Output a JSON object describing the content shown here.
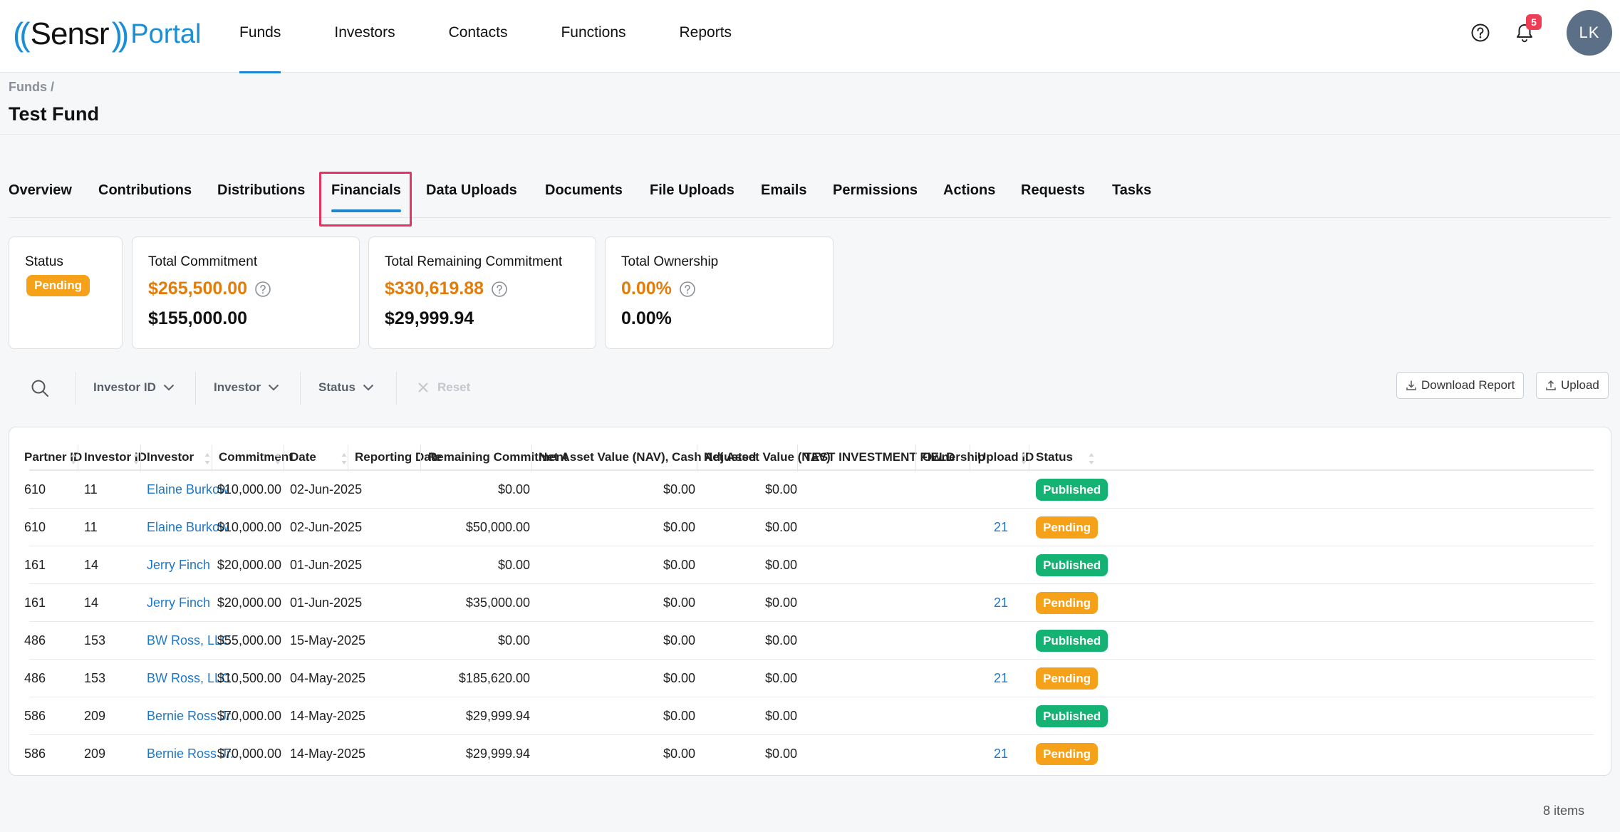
{
  "brand": {
    "left_paren": "((",
    "name": "Sensr",
    "right_paren": "))",
    "product": "Portal"
  },
  "nav": {
    "items": [
      {
        "label": "Funds",
        "active": true
      },
      {
        "label": "Investors"
      },
      {
        "label": "Contacts"
      },
      {
        "label": "Functions"
      },
      {
        "label": "Reports"
      }
    ],
    "notifications_count": "5",
    "avatar_initials": "LK"
  },
  "breadcrumb": "Funds /",
  "page_title": "Test Fund",
  "tabs": [
    {
      "label": "Overview"
    },
    {
      "label": "Contributions"
    },
    {
      "label": "Distributions"
    },
    {
      "label": "Financials",
      "active": true
    },
    {
      "label": "Data Uploads"
    },
    {
      "label": "Documents"
    },
    {
      "label": "File Uploads"
    },
    {
      "label": "Emails"
    },
    {
      "label": "Permissions"
    },
    {
      "label": "Actions"
    },
    {
      "label": "Requests"
    },
    {
      "label": "Tasks"
    }
  ],
  "summary": {
    "status": {
      "label": "Status",
      "value": "Pending"
    },
    "total_commitment": {
      "label": "Total Commitment",
      "pending": "$265,500.00",
      "published": "$155,000.00"
    },
    "total_remaining": {
      "label": "Total Remaining Commitment",
      "pending": "$330,619.88",
      "published": "$29,999.94"
    },
    "total_ownership": {
      "label": "Total Ownership",
      "pending": "0.00%",
      "published": "0.00%"
    }
  },
  "filters": {
    "investor_id": "Investor ID",
    "investor": "Investor",
    "status": "Status",
    "reset": "Reset",
    "download_report": "Download Report",
    "upload": "Upload"
  },
  "table": {
    "columns": [
      "Partner ID",
      "Investor ID",
      "Investor",
      "Commitment",
      "Date",
      "Reporting Date",
      "Remaining Commitment",
      "Net Asset Value (NAV), Cash Adjusted",
      "Net Asset Value (NAV)",
      "TEST INVESTMENT FIELD",
      "Ownership",
      "Upload ID",
      "Status"
    ],
    "rows": [
      {
        "partner_id": "610",
        "investor_id": "11",
        "investor": "Elaine Burkow",
        "commitment": "$10,000.00",
        "date": "02-Jun-2025",
        "reporting_date": "",
        "remaining": "$0.00",
        "nav_cash": "$0.00",
        "nav": "$0.00",
        "test_field": "",
        "ownership": "",
        "upload_id": "",
        "status": "Published"
      },
      {
        "partner_id": "610",
        "investor_id": "11",
        "investor": "Elaine Burkow",
        "commitment": "$10,000.00",
        "date": "02-Jun-2025",
        "reporting_date": "",
        "remaining": "$50,000.00",
        "nav_cash": "$0.00",
        "nav": "$0.00",
        "test_field": "",
        "ownership": "",
        "upload_id": "21",
        "status": "Pending"
      },
      {
        "partner_id": "161",
        "investor_id": "14",
        "investor": "Jerry Finch",
        "commitment": "$20,000.00",
        "date": "01-Jun-2025",
        "reporting_date": "",
        "remaining": "$0.00",
        "nav_cash": "$0.00",
        "nav": "$0.00",
        "test_field": "",
        "ownership": "",
        "upload_id": "",
        "status": "Published"
      },
      {
        "partner_id": "161",
        "investor_id": "14",
        "investor": "Jerry Finch",
        "commitment": "$20,000.00",
        "date": "01-Jun-2025",
        "reporting_date": "",
        "remaining": "$35,000.00",
        "nav_cash": "$0.00",
        "nav": "$0.00",
        "test_field": "",
        "ownership": "",
        "upload_id": "21",
        "status": "Pending"
      },
      {
        "partner_id": "486",
        "investor_id": "153",
        "investor": "BW Ross, LLC",
        "commitment": "$55,000.00",
        "date": "15-May-2025",
        "reporting_date": "",
        "remaining": "$0.00",
        "nav_cash": "$0.00",
        "nav": "$0.00",
        "test_field": "",
        "ownership": "",
        "upload_id": "",
        "status": "Published"
      },
      {
        "partner_id": "486",
        "investor_id": "153",
        "investor": "BW Ross, LLC",
        "commitment": "$10,500.00",
        "date": "04-May-2025",
        "reporting_date": "",
        "remaining": "$185,620.00",
        "nav_cash": "$0.00",
        "nav": "$0.00",
        "test_field": "",
        "ownership": "",
        "upload_id": "21",
        "status": "Pending"
      },
      {
        "partner_id": "586",
        "investor_id": "209",
        "investor": "Bernie Ross Jr.",
        "commitment": "$70,000.00",
        "date": "14-May-2025",
        "reporting_date": "",
        "remaining": "$29,999.94",
        "nav_cash": "$0.00",
        "nav": "$0.00",
        "test_field": "",
        "ownership": "",
        "upload_id": "",
        "status": "Published"
      },
      {
        "partner_id": "586",
        "investor_id": "209",
        "investor": "Bernie Ross Jr.",
        "commitment": "$70,000.00",
        "date": "14-May-2025",
        "reporting_date": "",
        "remaining": "$29,999.94",
        "nav_cash": "$0.00",
        "nav": "$0.00",
        "test_field": "",
        "ownership": "",
        "upload_id": "21",
        "status": "Pending"
      }
    ],
    "items_count": "8 items"
  },
  "colors": {
    "accent": "#1f86d0",
    "pending": "#f5a11a",
    "published": "#14b374",
    "amount_pending": "#e27c0a",
    "highlight": "#e8325f"
  }
}
